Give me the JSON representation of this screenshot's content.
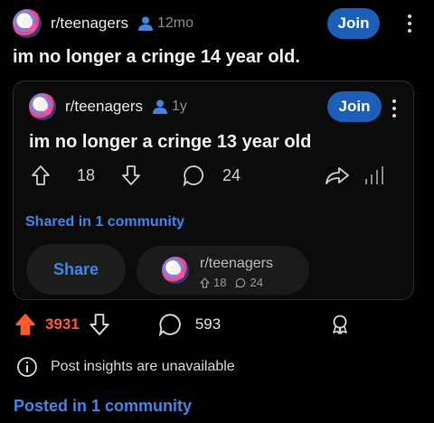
{
  "post": {
    "subreddit": "r/teenagers",
    "age": "12mo",
    "join_label": "Join",
    "title": "im no longer a cringe 14 year old."
  },
  "crosspost": {
    "subreddit": "r/teenagers",
    "age": "1y",
    "join_label": "Join",
    "title": "im no longer a cringe 13 year old",
    "upvotes": "18",
    "comments": "24",
    "shared_text": "Shared in 1 community",
    "share_label": "Share",
    "chip": {
      "name": "r/teenagers",
      "upvotes": "18",
      "comments": "24"
    }
  },
  "actions": {
    "upvotes": "3931",
    "comments": "593"
  },
  "insights_text": "Post insights are unavailable",
  "posted_text": "Posted in 1 community",
  "colors": {
    "join": "#1b5fb8",
    "link": "#3e86e8",
    "upvote": "#ff5a2a"
  },
  "icons": [
    "user-icon",
    "kebab-icon",
    "upvote-icon",
    "downvote-icon",
    "comment-icon",
    "share-arrow-icon",
    "insights-bars-icon",
    "award-icon",
    "info-icon"
  ]
}
